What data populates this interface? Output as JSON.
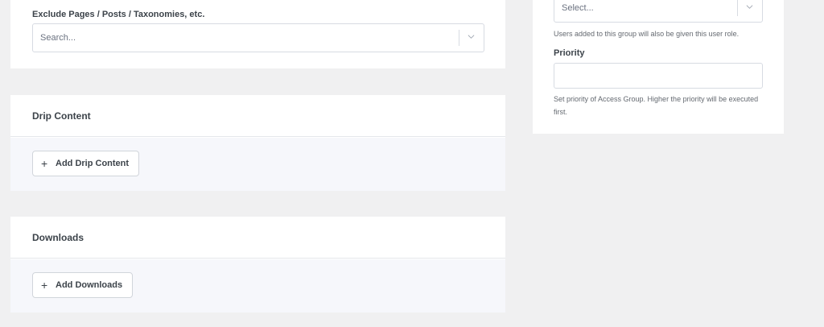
{
  "exclude": {
    "label": "Exclude Pages / Posts / Taxonomies, etc.",
    "placeholder": "Search..."
  },
  "drip": {
    "title": "Drip Content",
    "button_label": "Add Drip Content"
  },
  "downloads": {
    "title": "Downloads",
    "button_label": "Add Downloads"
  },
  "sidebar": {
    "role_select": {
      "placeholder": "Select...",
      "help": "Users added to this group will also be given this user role."
    },
    "priority": {
      "label": "Priority",
      "value": "",
      "help": "Set priority of Access Group. Higher the priority will be executed first."
    }
  },
  "icons": {
    "plus": "+",
    "dropdown": "chevron-down-icon"
  }
}
